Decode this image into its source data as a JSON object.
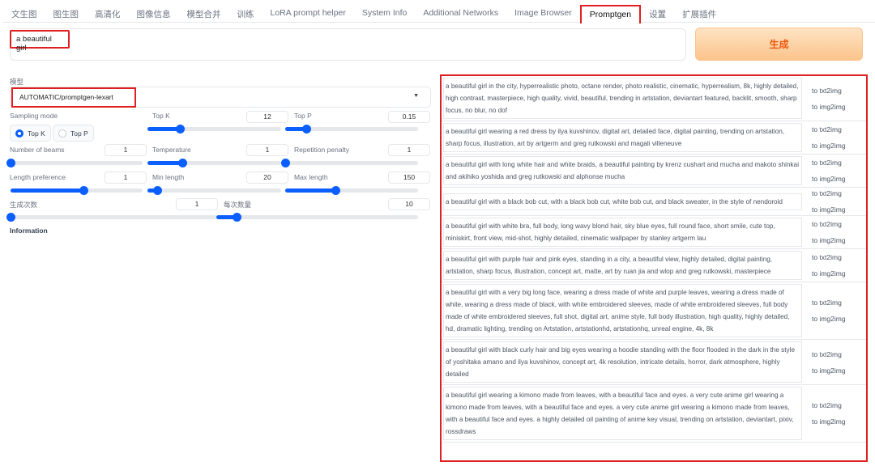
{
  "tabs": [
    "文生图",
    "图生图",
    "高清化",
    "图像信息",
    "模型合并",
    "训练",
    "LoRA prompt helper",
    "System Info",
    "Additional Networks",
    "Image Browser",
    "Promptgen",
    "设置",
    "扩展插件"
  ],
  "active_tab": "Promptgen",
  "prompt": {
    "value": "a  beautiful girl"
  },
  "generate_label": "生成",
  "model": {
    "label": "模型",
    "value": "AUTOMATIC/promptgen-lexart"
  },
  "sampling": {
    "label": "Sampling mode",
    "options": [
      "Top K",
      "Top P"
    ],
    "selected": "Top K"
  },
  "params": {
    "top_k": {
      "label": "Top K",
      "value": "12",
      "fill": 0.24
    },
    "top_p": {
      "label": "Top P",
      "value": "0.15",
      "fill": 0.16
    },
    "beams": {
      "label": "Number of beams",
      "value": "1",
      "fill": 0
    },
    "temperature": {
      "label": "Temperature",
      "value": "1",
      "fill": 0.26
    },
    "rep_penalty": {
      "label": "Repetition penalty",
      "value": "1",
      "fill": 0
    },
    "length_pref": {
      "label": "Length preference",
      "value": "1",
      "fill": 0.55
    },
    "min_length": {
      "label": "Min length",
      "value": "20",
      "fill": 0.07
    },
    "max_length": {
      "label": "Max length",
      "value": "150",
      "fill": 0.38
    },
    "batch_count": {
      "label": "生成次数",
      "value": "1",
      "fill": 0
    },
    "batch_size": {
      "label": "每次数量",
      "value": "10",
      "fill": 0.1
    }
  },
  "information_label": "Information",
  "actions": {
    "txt2img": "to txt2img",
    "img2img": "to img2img"
  },
  "results": [
    "a beautiful girl in the city, hyperrealistic photo, octane render, photo realistic, cinematic, hyperrealism, 8k, highly detailed, high contrast, masterpiece, high quality, vivid, beautiful, trending in artstation, deviantart featured, backlit, smooth, sharp focus, no blur, no dof",
    "a beautiful girl wearing a red dress by ilya kuvshinov, digital art, detailed face, digital painting, trending on artstation, sharp focus, illustration, art by artgerm and greg rutkowski and magali villeneuve",
    "a beautiful girl with long white hair and white braids, a beautiful painting by krenz cushart and mucha and makoto shinkai and akihiko yoshida and greg rutkowski and alphonse mucha",
    "a beautiful girl with a black bob cut, with a black bob cut, white bob cut, and black sweater, in the style of nendoroid",
    "a beautiful girl with white bra, full body, long wavy blond hair, sky blue eyes, full round face, short smile, cute top, miniskirt, front view, mid-shot, highly detailed, cinematic wallpaper by stanley artgerm lau",
    "a beautiful girl with purple hair and pink eyes, standing in a city, a beautiful view, highly detailed, digital painting, artstation, sharp focus, illustration, concept art, matte, art by ruan jia and wlop and greg rutkowski, masterpiece",
    "a beautiful girl with a very big long face, wearing a dress made of white and purple leaves, wearing a dress made of white, wearing a dress made of black, with white embroidered sleeves, made of white embroidered sleeves, full body made of white embroidered sleeves, full shot, digital art, anime style, full body illustration, high quality, highly detailed, hd, dramatic lighting, trending on Artstation, artstationhd, artstationhq, unreal engine, 4k, 8k",
    "a beautiful girl with black curly hair and big eyes wearing a hoodie standing with the floor flooded in the dark in the style of yoshitaka amano and ilya kuvshinov, concept art, 4k resolution, intricate details, horror, dark atmosphere, highly detailed",
    "a beautiful girl wearing a kimono made from leaves, with a beautiful face and eyes. a very cute anime girl wearing a kimono made from leaves, with a beautiful face and eyes. a very cute anime girl wearing a kimono made from leaves, with a beautiful face and eyes. a highly detailed oil painting of anime key visual, trending on artstation, deviantart, pixiv, rossdraws"
  ]
}
